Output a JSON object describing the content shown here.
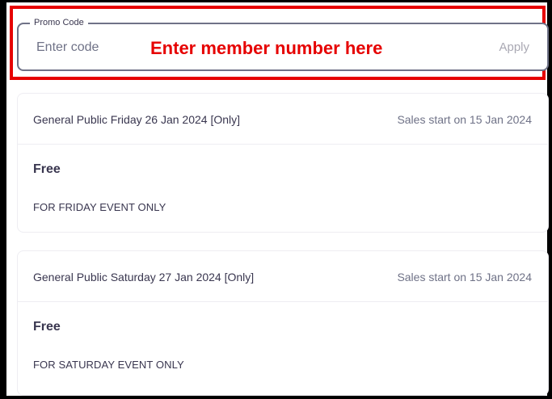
{
  "promo": {
    "legend": "Promo Code",
    "placeholder": "Enter code",
    "value": "",
    "annotation": "Enter member number here",
    "apply_label": "Apply",
    "accent_color": "#e60000"
  },
  "tickets": [
    {
      "title": "General Public Friday 26 Jan 2024 [Only]",
      "sales_status": "Sales start on 15 Jan 2024",
      "price": "Free",
      "description": "FOR FRIDAY EVENT ONLY"
    },
    {
      "title": "General Public Saturday 27 Jan 2024 [Only]",
      "sales_status": "Sales start on 15 Jan 2024",
      "price": "Free",
      "description": "FOR SATURDAY EVENT ONLY"
    }
  ]
}
